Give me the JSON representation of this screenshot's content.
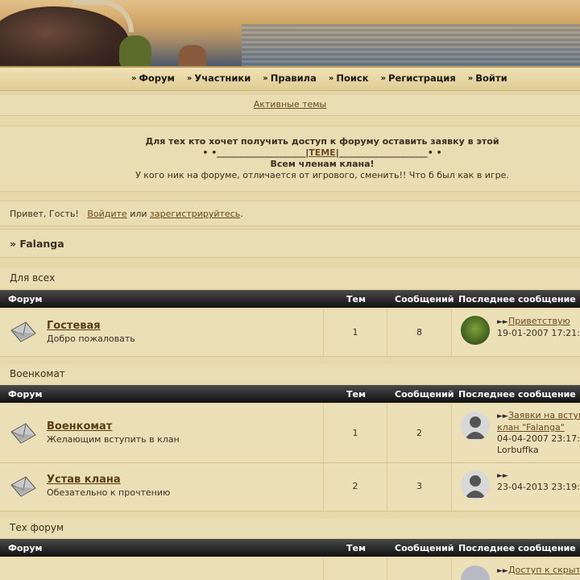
{
  "nav": {
    "items": [
      {
        "label": "Форум"
      },
      {
        "label": "Участники"
      },
      {
        "label": "Правила"
      },
      {
        "label": "Поиск"
      },
      {
        "label": "Регистрация"
      },
      {
        "label": "Войти"
      }
    ]
  },
  "active_topics": "Активные темы",
  "notice": {
    "line1": "Для тех кто хочет получить доступ к форуму оставить заявку в этой",
    "line2_left": "• •____________________|",
    "line2_link": "ТЕМЕ",
    "line2_right": "|____________________• •",
    "line3": "Всем членам клана!",
    "line4": "У кого ник на форуме, отличается от игрового, сменить!! Что б был как в игре."
  },
  "greeting": {
    "prefix": "Привет, Гость!",
    "login": "Войдите",
    "or": "или",
    "register": "зарегистрируйтесь",
    "suffix": "."
  },
  "breadcrumb": "» Falanga",
  "columns": {
    "forum": "Форум",
    "topics": "Тем",
    "posts": "Сообщений",
    "last": "Последнее сообщение"
  },
  "categories": [
    {
      "title": "Для всех",
      "forums": [
        {
          "name": "Гостевая",
          "desc": "Добро пожаловать",
          "topics": "1",
          "posts": "8",
          "last_title": "Приветствую",
          "last_title2": "",
          "last_date": "19-01-2007 17:21:",
          "last_author": ""
        }
      ]
    },
    {
      "title": "Военкомат",
      "forums": [
        {
          "name": "Военкомат",
          "desc": "Желающим вступить в клан",
          "topics": "1",
          "posts": "2",
          "last_title": "Заявки на вступ",
          "last_title2": "клан \"Falanga\"",
          "last_date": "04-04-2007 23:17:",
          "last_author": "Lorbuffka"
        },
        {
          "name": "Устав клана",
          "desc": "Обезательно к прочтению",
          "topics": "2",
          "posts": "3",
          "last_title": "",
          "last_title2": "",
          "last_date": "23-04-2013 23:19:",
          "last_author": ""
        }
      ]
    },
    {
      "title": "Тех форум",
      "forums": [
        {
          "name": "",
          "desc": "",
          "topics": "",
          "posts": "",
          "last_title": "Доступ к скрыт",
          "last_title2": "",
          "last_date": "",
          "last_author": ""
        }
      ]
    }
  ]
}
